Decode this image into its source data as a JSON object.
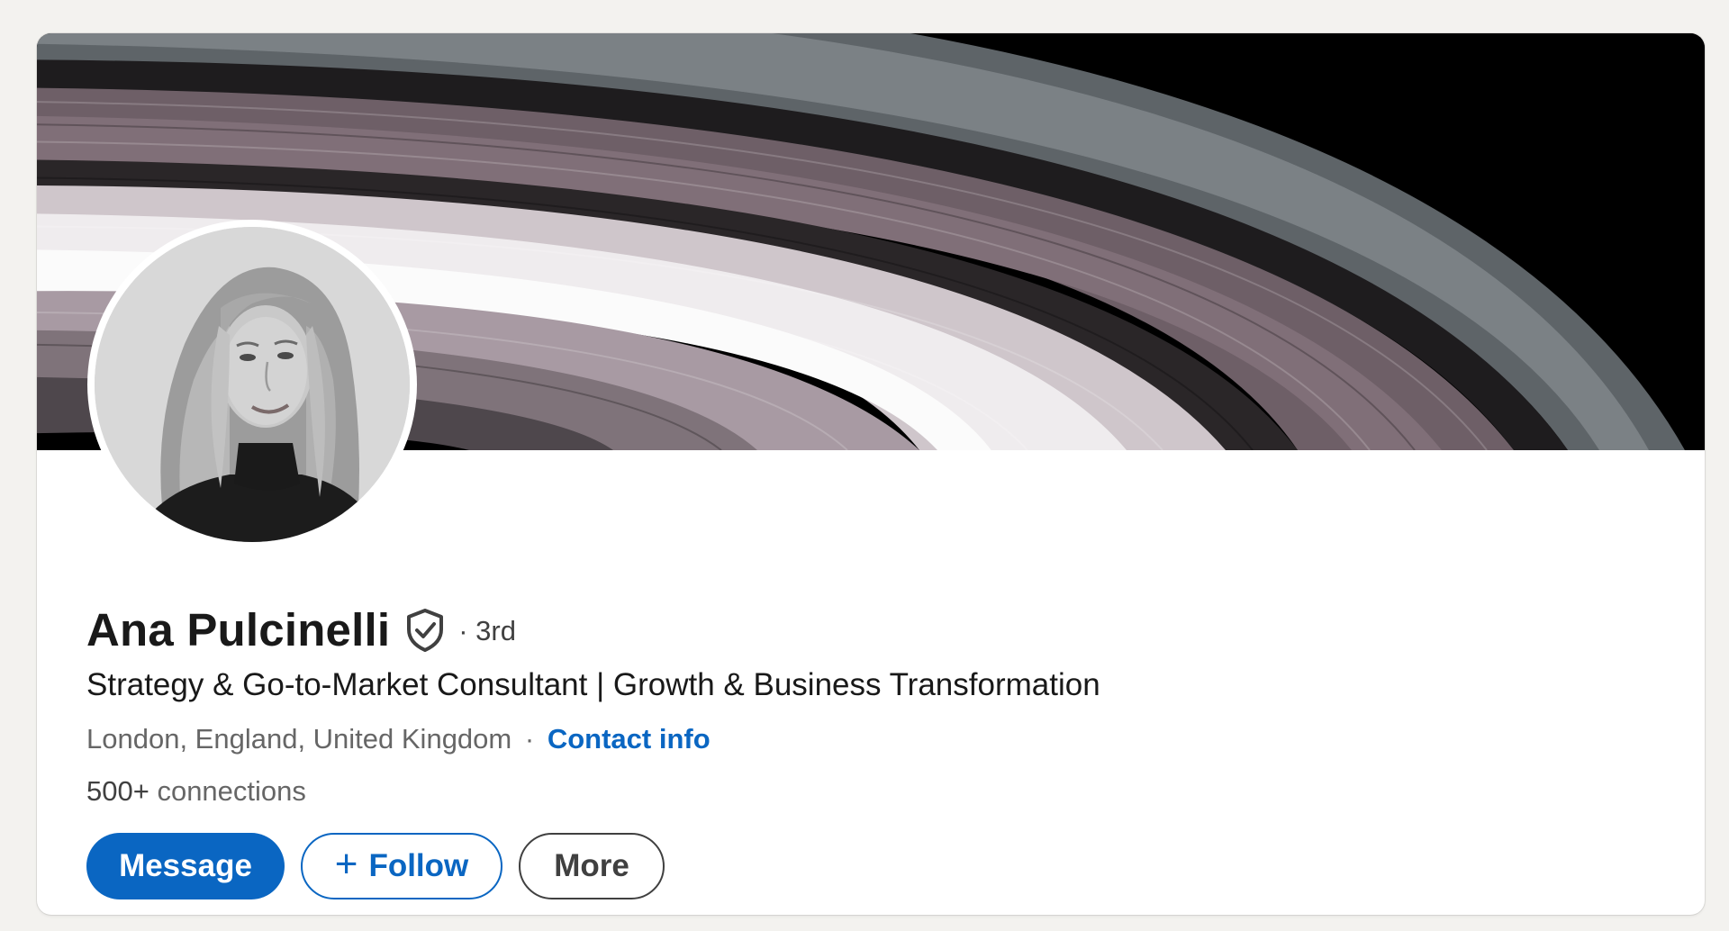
{
  "profile": {
    "name": "Ana Pulcinelli",
    "degree": "· 3rd",
    "headline": "Strategy & Go-to-Market Consultant | Growth & Business Transformation",
    "location": "London, England, United Kingdom",
    "separator": "·",
    "contact_info_label": "Contact info",
    "connections_count": "500+",
    "connections_label": "connections",
    "verified_icon": "verified-shield-icon",
    "avatar": "profile-photo"
  },
  "actions": {
    "message_label": "Message",
    "follow_label": "Follow",
    "follow_icon": "plus-icon",
    "more_label": "More"
  },
  "colors": {
    "primary": "#0a66c2",
    "background": "#f3f2ef",
    "card": "#ffffff",
    "text_primary": "#191919",
    "text_secondary": "#666666"
  }
}
